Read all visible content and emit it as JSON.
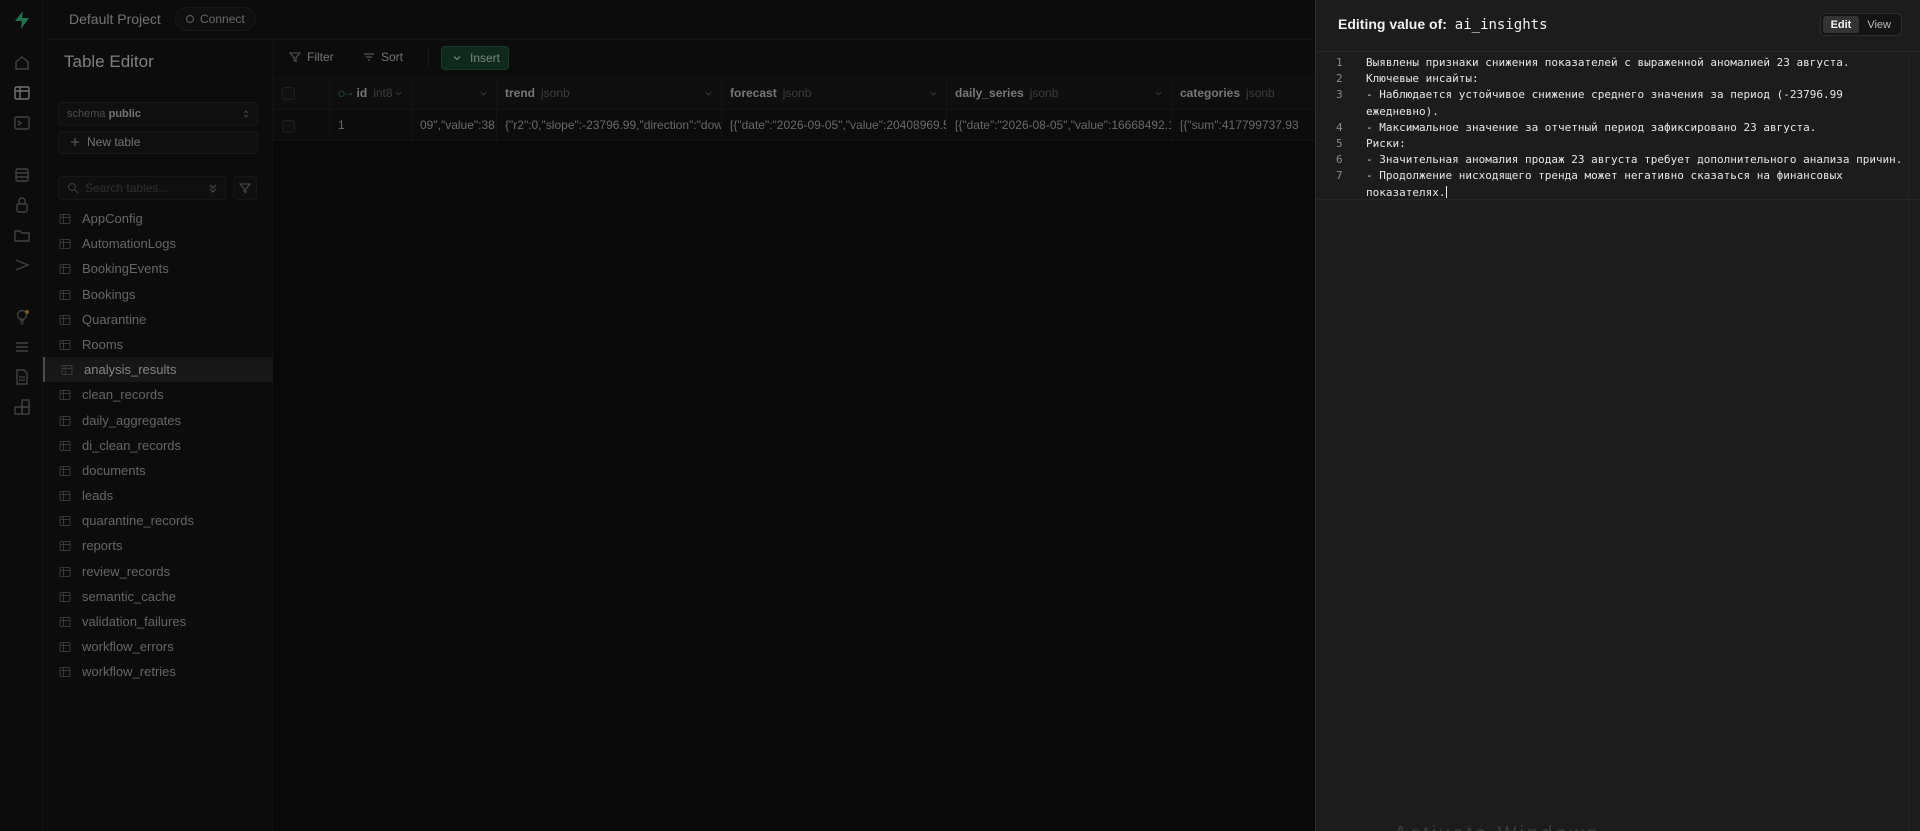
{
  "topbar": {
    "project": "Default Project",
    "connect_label": "Connect"
  },
  "sidebar": {
    "title": "Table Editor",
    "schema_prefix": "schema",
    "schema_value": "public",
    "new_table_label": "New table",
    "search_placeholder": "Search tables...",
    "tables": [
      "AppConfig",
      "AutomationLogs",
      "BookingEvents",
      "Bookings",
      "Quarantine",
      "Rooms",
      "analysis_results",
      "clean_records",
      "daily_aggregates",
      "di_clean_records",
      "documents",
      "leads",
      "quarantine_records",
      "reports",
      "review_records",
      "semantic_cache",
      "validation_failures",
      "workflow_errors",
      "workflow_retries"
    ],
    "active_table": "analysis_results"
  },
  "toolbar": {
    "filter_label": "Filter",
    "sort_label": "Sort",
    "insert_label": "Insert"
  },
  "grid": {
    "columns": [
      {
        "name": "id",
        "type": "int8"
      },
      {
        "name": "",
        "type": ""
      },
      {
        "name": "trend",
        "type": "jsonb"
      },
      {
        "name": "forecast",
        "type": "jsonb"
      },
      {
        "name": "daily_series",
        "type": "jsonb"
      },
      {
        "name": "categories",
        "type": "jsonb"
      }
    ],
    "row": {
      "id": "1",
      "c1": "09\",\"value\":38",
      "trend": "{\"r2\":0,\"slope\":-23796.99,\"direction\":\"dow",
      "forecast": "[{\"date\":\"2026-09-05\",\"value\":20408969.5",
      "daily_series": "[{\"date\":\"2026-08-05\",\"value\":16668492.1",
      "categories": "[{\"sum\":417799737.93"
    }
  },
  "panel": {
    "title_prefix": "Editing value of:",
    "field_name": "ai_insights",
    "edit_label": "Edit",
    "view_label": "View",
    "lines": [
      {
        "n": "1",
        "text": "Выявлены признаки снижения показателей с выраженной аномалией 23 августа."
      },
      {
        "n": "2",
        "text": "Ключевые инсайты:"
      },
      {
        "n": "3",
        "text": "- Наблюдается устойчивое снижение среднего значения за период (-23796.99 ежедневно)."
      },
      {
        "n": "4",
        "text": "- Максимальное значение за отчетный период зафиксировано 23 августа."
      },
      {
        "n": "5",
        "text": "Риски:"
      },
      {
        "n": "6",
        "text": "- Значительная аномалия продаж 23 августа требует дополнительного анализа причин."
      },
      {
        "n": "7",
        "text": "- Продолжение нисходящего тренда может негативно сказаться на финансовых показателях."
      }
    ],
    "watermark": "Activate Windows"
  }
}
